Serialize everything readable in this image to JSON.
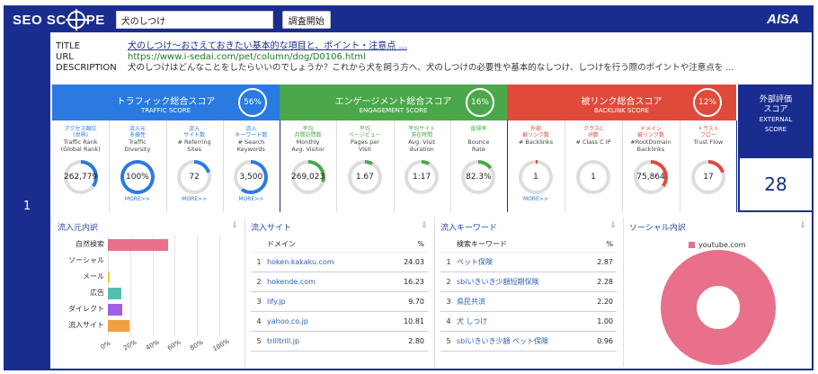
{
  "header": {
    "logo": "SEO SC",
    "logo_tail": "PE",
    "search_value": "犬のしつけ",
    "search_button": "調査開始",
    "brand": "AISA"
  },
  "row_number": "1",
  "meta": {
    "title_key": "TITLE",
    "title_value": "犬のしつけ〜おさえておきたい基本的な項目と、ポイント・注意点 ...",
    "url_key": "URL",
    "url_value": "https://www.i-sedai.com/pet/column/dog/D0106.html",
    "desc_key": "DESCRIPTION",
    "desc_value": "犬のしつけはどんなことをしたらいいのでしょうか？これから犬を飼う方へ、犬のしつけの必要性や基本的なしつけ、しつけを行う際のポイントや注意点を ..."
  },
  "sections": {
    "traffic": {
      "title": "トラフィック総合スコア",
      "sub": "TRAFFIC SCORE",
      "pct": "56%",
      "color": "#2a7ae2"
    },
    "engage": {
      "title": "エンゲージメント総合スコア",
      "sub": "ENGAGEMENT SCORE",
      "pct": "16%",
      "color": "#4aa84a"
    },
    "backlink": {
      "title": "被リンク総合スコア",
      "sub": "BACKLINK SCORE",
      "pct": "12%",
      "color": "#e04a3a"
    }
  },
  "metrics": [
    {
      "jp": "アクセス順位\n(世界)",
      "en": "Traffic Rank\n(Global Rank)",
      "value": "262,779",
      "fill": 0.35,
      "color": "#2a7ae2",
      "more": ""
    },
    {
      "jp": "流入元\n多様性",
      "en": "Traffic\nDiversity",
      "value": "100%",
      "fill": 1.0,
      "color": "#2a7ae2",
      "more": "MORE>>"
    },
    {
      "jp": "流入\nサイト数",
      "en": "# Referring\nSites",
      "value": "72",
      "fill": 0.2,
      "color": "#2a7ae2",
      "more": "MORE>>"
    },
    {
      "jp": "流入\nキーワード数",
      "en": "# Search\nKeywords",
      "value": "3,500",
      "fill": 0.6,
      "color": "#2a7ae2",
      "more": "MORE>>"
    },
    {
      "jp": "平均\n月間訪問数",
      "en": "Monthly\nAvg. Visitor",
      "value": "269,023",
      "fill": 0.3,
      "color": "#4aa84a",
      "more": ""
    },
    {
      "jp": "平均\nページビュー",
      "en": "Pages per\nVisit",
      "value": "1.67",
      "fill": 0.08,
      "color": "#4aa84a",
      "more": ""
    },
    {
      "jp": "平均サイト\n滞在時間",
      "en": "Avg. Visit\nduration",
      "value": "1:17",
      "fill": 0.08,
      "color": "#4aa84a",
      "more": ""
    },
    {
      "jp": "直帰率",
      "en": "Bounce\nRate",
      "value": "82.3%",
      "fill": 0.15,
      "color": "#4aa84a",
      "more": ""
    },
    {
      "jp": "外部\n被リンク数",
      "en": "# Backlinks",
      "value": "1",
      "fill": 0.02,
      "color": "#e04a3a",
      "more": "MORE>>"
    },
    {
      "jp": "クラスC\nIP数",
      "en": "# Class C IP",
      "value": "1",
      "fill": 0.0,
      "color": "#e04a3a",
      "more": ""
    },
    {
      "jp": "ドメイン\n被リンク数",
      "en": "#RootDomain\nBacklinks",
      "value": "75,864",
      "fill": 0.35,
      "color": "#e04a3a",
      "more": ""
    },
    {
      "jp": "トラスト\nフロー",
      "en": "Trust Flow",
      "value": "17",
      "fill": 0.2,
      "color": "#e04a3a",
      "more": ""
    }
  ],
  "external": {
    "title": "外部評価\nスコア",
    "sub": "EXTERNAL\nSCORE",
    "value": "28"
  },
  "panels": {
    "traffic_source": {
      "title": "流入元内訳",
      "chart_data": {
        "type": "bar",
        "categories": [
          "自然検索",
          "ソーシャル",
          "メール",
          "広告",
          "ダイレクト",
          "流入サイト"
        ],
        "values": [
          54,
          0,
          2,
          12,
          13,
          19
        ],
        "colors": [
          "#e8708a",
          "#c0c0c0",
          "#e8d040",
          "#50c0b0",
          "#a060e0",
          "#f0a040"
        ],
        "ticks": [
          "0%",
          "20%",
          "40%",
          "60%",
          "80%",
          "100%"
        ],
        "xlim": [
          0,
          100
        ]
      }
    },
    "ref_sites": {
      "title": "流入サイト",
      "h_domain": "ドメイン",
      "h_pct": "%",
      "rows": [
        {
          "n": "1",
          "d": "hoken.kakaku.com",
          "p": "24.03"
        },
        {
          "n": "2",
          "d": "hokende.com",
          "p": "16.23"
        },
        {
          "n": "3",
          "d": "lify.jp",
          "p": "9.70"
        },
        {
          "n": "4",
          "d": "yahoo.co.jp",
          "p": "10.81"
        },
        {
          "n": "5",
          "d": "trilltrill.jp",
          "p": "2.80"
        }
      ]
    },
    "keywords": {
      "title": "流入キーワード",
      "h_kw": "検索キーワード",
      "h_pct": "%",
      "rows": [
        {
          "n": "1",
          "d": "ペット保険",
          "p": "2.87"
        },
        {
          "n": "2",
          "d": "sbiいきいき少額短期保険",
          "p": "2.28"
        },
        {
          "n": "3",
          "d": "県民共済",
          "p": "2.20"
        },
        {
          "n": "4",
          "d": "犬 しつけ",
          "p": "1.00"
        },
        {
          "n": "5",
          "d": "sbiいきいき少額 ペット保険",
          "p": "0.96"
        }
      ]
    },
    "social": {
      "title": "ソーシャル内訳",
      "chart_data": {
        "type": "pie",
        "categories": [
          "youtube.com"
        ],
        "values": [
          100
        ],
        "colors": [
          "#e8708a"
        ]
      }
    }
  }
}
